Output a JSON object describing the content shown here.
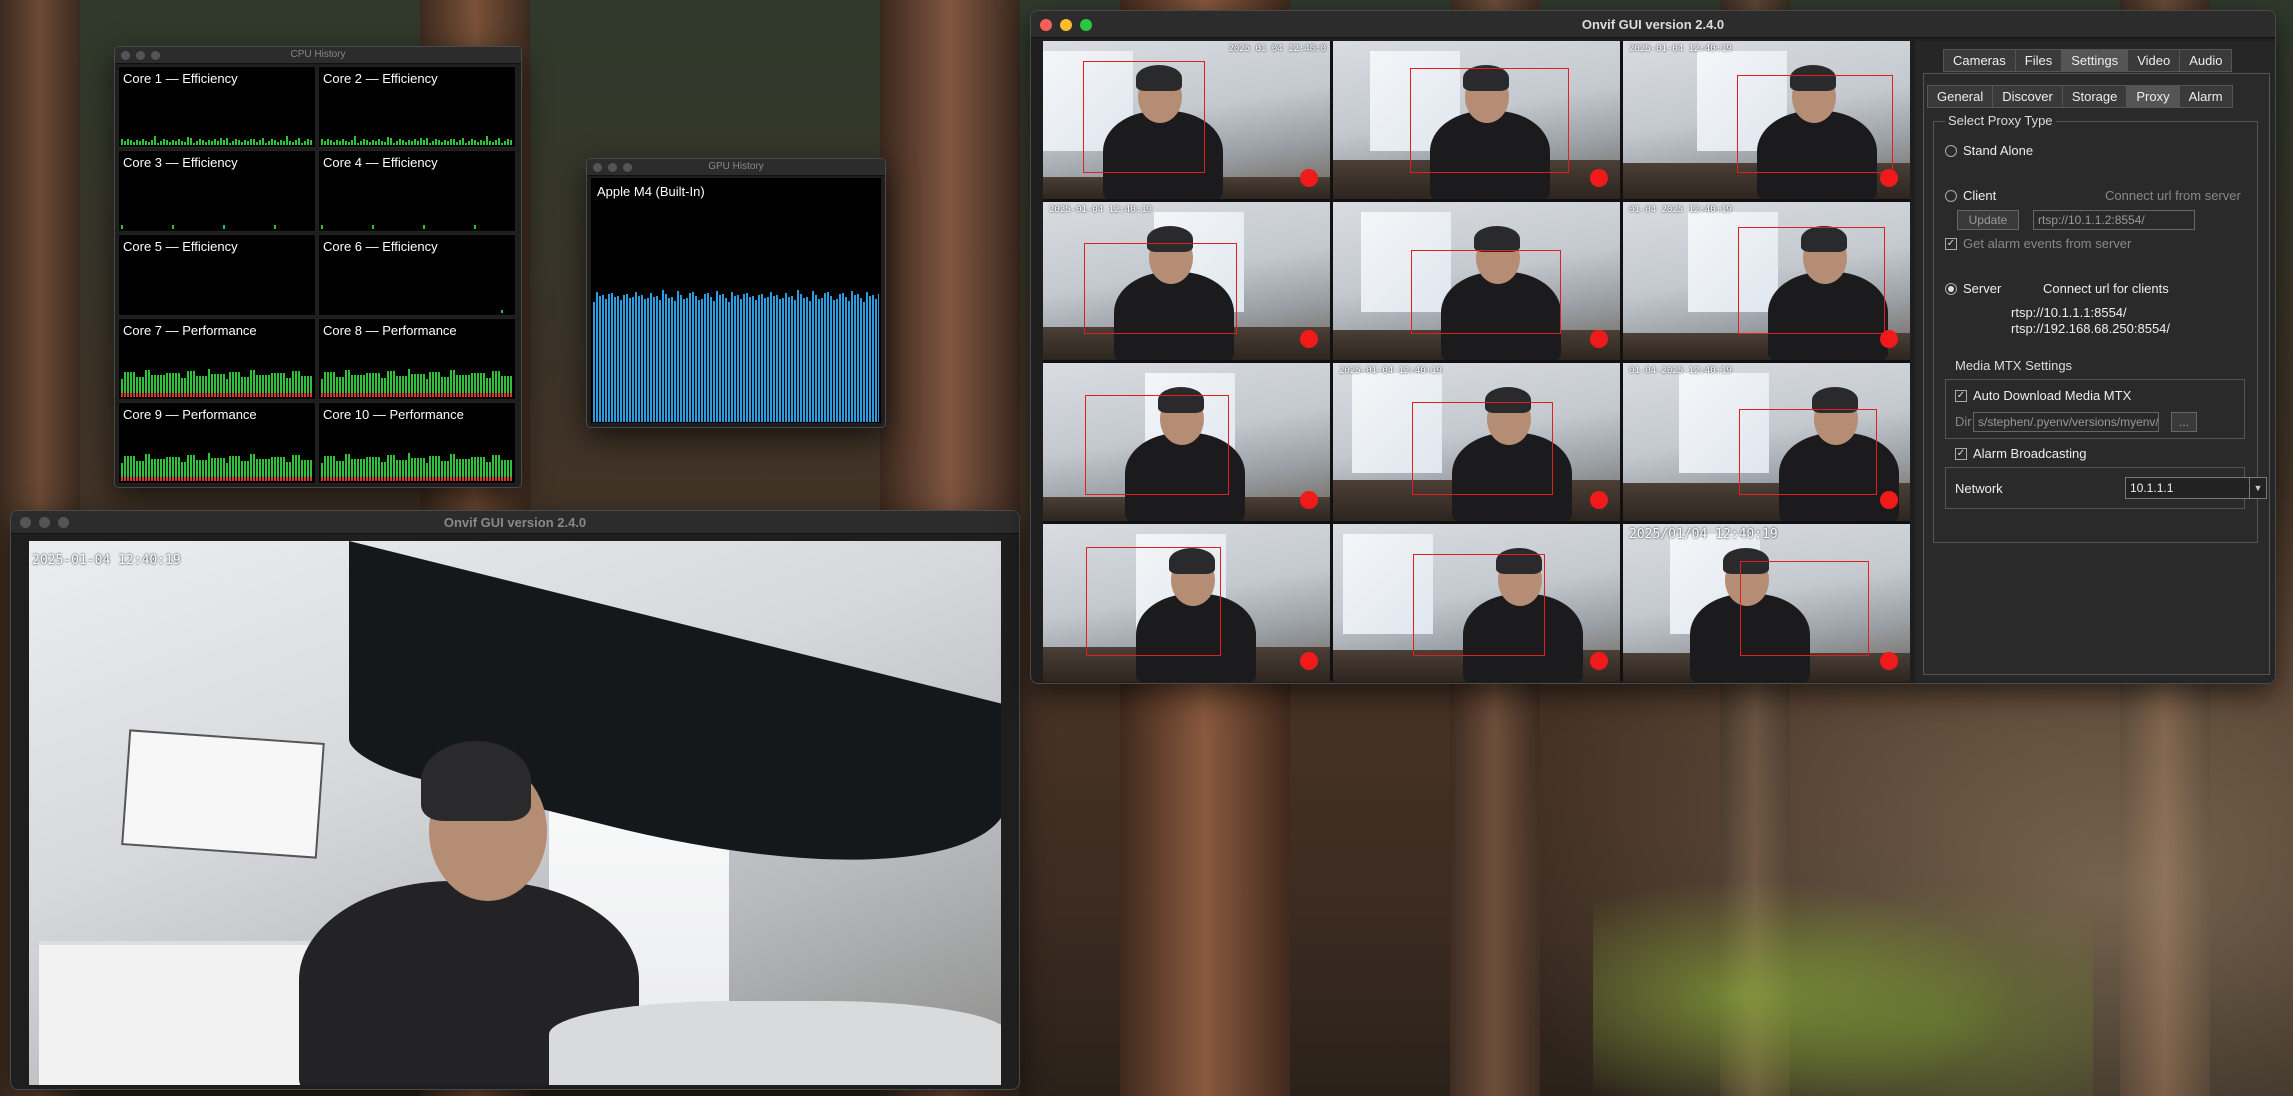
{
  "cpu_window": {
    "title": "CPU History",
    "cores": [
      {
        "label": "Core 1 — Efficiency",
        "type": "efficiency"
      },
      {
        "label": "Core 2 — Efficiency",
        "type": "efficiency"
      },
      {
        "label": "Core 3 — Efficiency",
        "type": "efficiency"
      },
      {
        "label": "Core 4 — Efficiency",
        "type": "efficiency"
      },
      {
        "label": "Core 5 — Efficiency",
        "type": "efficiency"
      },
      {
        "label": "Core 6 — Efficiency",
        "type": "efficiency"
      },
      {
        "label": "Core 7 — Performance",
        "type": "performance"
      },
      {
        "label": "Core 8 — Performance",
        "type": "performance"
      },
      {
        "label": "Core 9 — Performance",
        "type": "performance"
      },
      {
        "label": "Core 10 — Performance",
        "type": "performance"
      }
    ]
  },
  "gpu_window": {
    "title": "GPU History",
    "label": "Apple M4 (Built-In)"
  },
  "single_view_window": {
    "title": "Onvif GUI version 2.4.0",
    "timestamp": "2025-01-04 12:40:19"
  },
  "main_window": {
    "title": "Onvif GUI version 2.4.0",
    "grid_timestamps": [
      "2025 01 04 12:40:0",
      "",
      "2025-01-04 12:40:19",
      "2025-01-04 12:40:19",
      "",
      "01-04 2025 12:40:19",
      "",
      "2025-01-04 12:40:19",
      "01-04-2025 12:40:19",
      "",
      "",
      "2025/01/04 12:40:19"
    ],
    "main_tabs": [
      "Cameras",
      "Files",
      "Settings",
      "Video",
      "Audio"
    ],
    "active_main_tab": "Settings",
    "sub_tabs": [
      "General",
      "Discover",
      "Storage",
      "Proxy",
      "Alarm"
    ],
    "active_sub_tab": "Proxy",
    "proxy": {
      "group_title": "Select Proxy Type",
      "stand_alone_label": "Stand Alone",
      "client_label": "Client",
      "connect_from_server_label": "Connect url from server",
      "update_label": "Update",
      "client_url": "rtsp://10.1.1.2:8554/",
      "get_alarm_label": "Get alarm events from server",
      "server_label": "Server",
      "connect_clients_label": "Connect url for clients",
      "server_urls": [
        "rtsp://10.1.1.1:8554/",
        "rtsp://192.168.68.250:8554/"
      ],
      "selected": "Server"
    },
    "mediamtx": {
      "title": "Media MTX Settings",
      "auto_download_label": "Auto Download Media MTX",
      "dir_label": "Dir",
      "dir_value": "s/stephen/.pyenv/versions/myenv/bin",
      "browse_label": "...",
      "alarm_broadcasting_label": "Alarm Broadcasting",
      "network_label": "Network",
      "network_value": "10.1.1.1"
    }
  }
}
